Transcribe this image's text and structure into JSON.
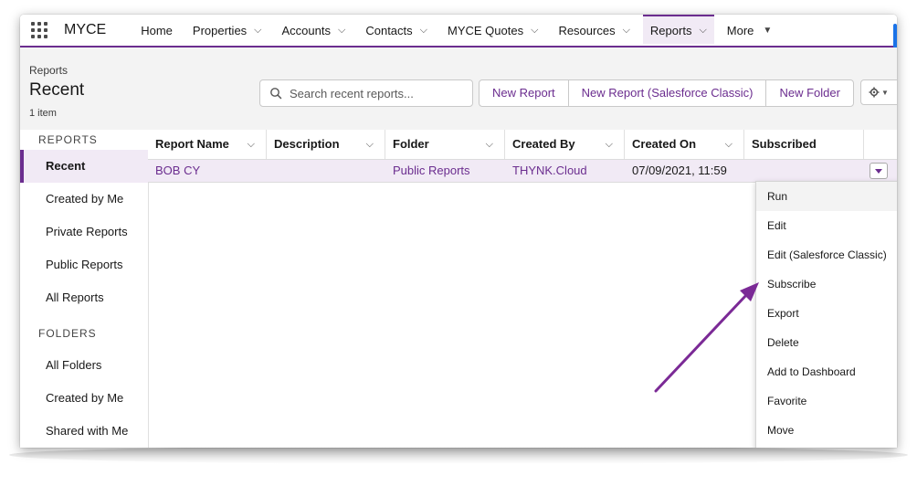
{
  "app": {
    "name": "MYCE"
  },
  "nav": {
    "items": [
      {
        "label": "Home",
        "chevron": false
      },
      {
        "label": "Properties",
        "chevron": true
      },
      {
        "label": "Accounts",
        "chevron": true
      },
      {
        "label": "Contacts",
        "chevron": true
      },
      {
        "label": "MYCE Quotes",
        "chevron": true
      },
      {
        "label": "Resources",
        "chevron": true
      },
      {
        "label": "Reports",
        "chevron": true,
        "active": true
      },
      {
        "label": "More",
        "dropdown": true
      }
    ]
  },
  "header": {
    "breadcrumb": "Reports",
    "title": "Recent",
    "count": "1 item",
    "search_placeholder": "Search recent reports...",
    "buttons": [
      "New Report",
      "New Report (Salesforce Classic)",
      "New Folder"
    ]
  },
  "sidebar": {
    "reports_heading": "REPORTS",
    "reports": [
      "Recent",
      "Created by Me",
      "Private Reports",
      "Public Reports",
      "All Reports"
    ],
    "folders_heading": "FOLDERS",
    "folders": [
      "All Folders",
      "Created by Me",
      "Shared with Me"
    ]
  },
  "table": {
    "columns": [
      "Report Name",
      "Description",
      "Folder",
      "Created By",
      "Created On",
      "Subscribed"
    ],
    "rows": [
      {
        "report_name": "BOB CY",
        "description": "",
        "folder": "Public Reports",
        "created_by": "THYNK.Cloud",
        "created_on": "07/09/2021, 11:59",
        "subscribed": ""
      }
    ]
  },
  "row_menu": {
    "items": [
      "Run",
      "Edit",
      "Edit (Salesforce Classic)",
      "Subscribe",
      "Export",
      "Delete",
      "Add to Dashboard",
      "Favorite",
      "Move"
    ]
  },
  "colors": {
    "accent": "#6b2d8f",
    "highlight": "#f1eaf5",
    "arrow": "#7b2a96"
  }
}
